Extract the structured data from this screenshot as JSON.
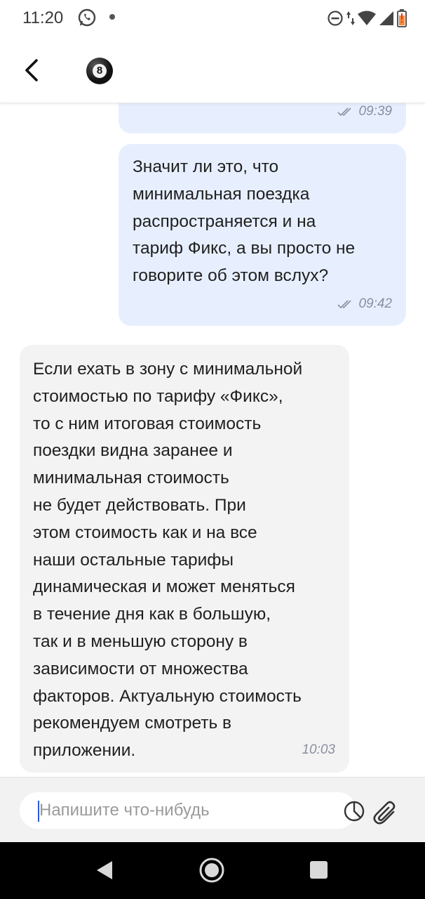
{
  "status_bar": {
    "time": "11:20",
    "icons": [
      "whatsapp-icon",
      "notification-dot-icon",
      "dnd-icon",
      "data-arrows-icon",
      "wifi-icon",
      "signal-icon",
      "battery-low-icon"
    ]
  },
  "header": {
    "back_icon": "chevron-left-icon",
    "avatar_text": "8"
  },
  "messages": [
    {
      "direction": "outgoing",
      "text": "",
      "time": "09:39",
      "status": "read"
    },
    {
      "direction": "outgoing",
      "text": "Значит ли это, что\nминимальная поездка\nраспространяется и на\nтариф Фикс, а вы просто не\nговорите об этом вслух?",
      "time": "09:42",
      "status": "read"
    },
    {
      "direction": "incoming",
      "text": "Если ехать в зону с минимальной\nстоимостью по тарифу «Фикс»,\nто с ним итоговая стоимость\nпоездки видна заранее и\nминимальная стоимость\nне будет действовать. При\nэтом стоимость как и на все\nнаши остальные тарифы\nдинамическая и может меняться\nв течение дня как в большую,\nтак и в меньшую сторону в\nзависимости от множества\nфакторов. Актуальную стоимость\nрекомендуем смотреть в\nприложении.",
      "time": "10:03"
    }
  ],
  "composer": {
    "placeholder": "Напишите что-нибудь",
    "value": "",
    "templates_icon": "quick-replies-icon",
    "attach_icon": "paperclip-icon"
  },
  "nav_bar": {
    "icons": [
      "nav-back-icon",
      "nav-home-icon",
      "nav-recents-icon"
    ]
  },
  "colors": {
    "outgoing_bubble": "#e7efff",
    "incoming_bubble": "#f3f3f3",
    "meta_text": "#8a8fa0",
    "cursor": "#2a5bd7"
  }
}
